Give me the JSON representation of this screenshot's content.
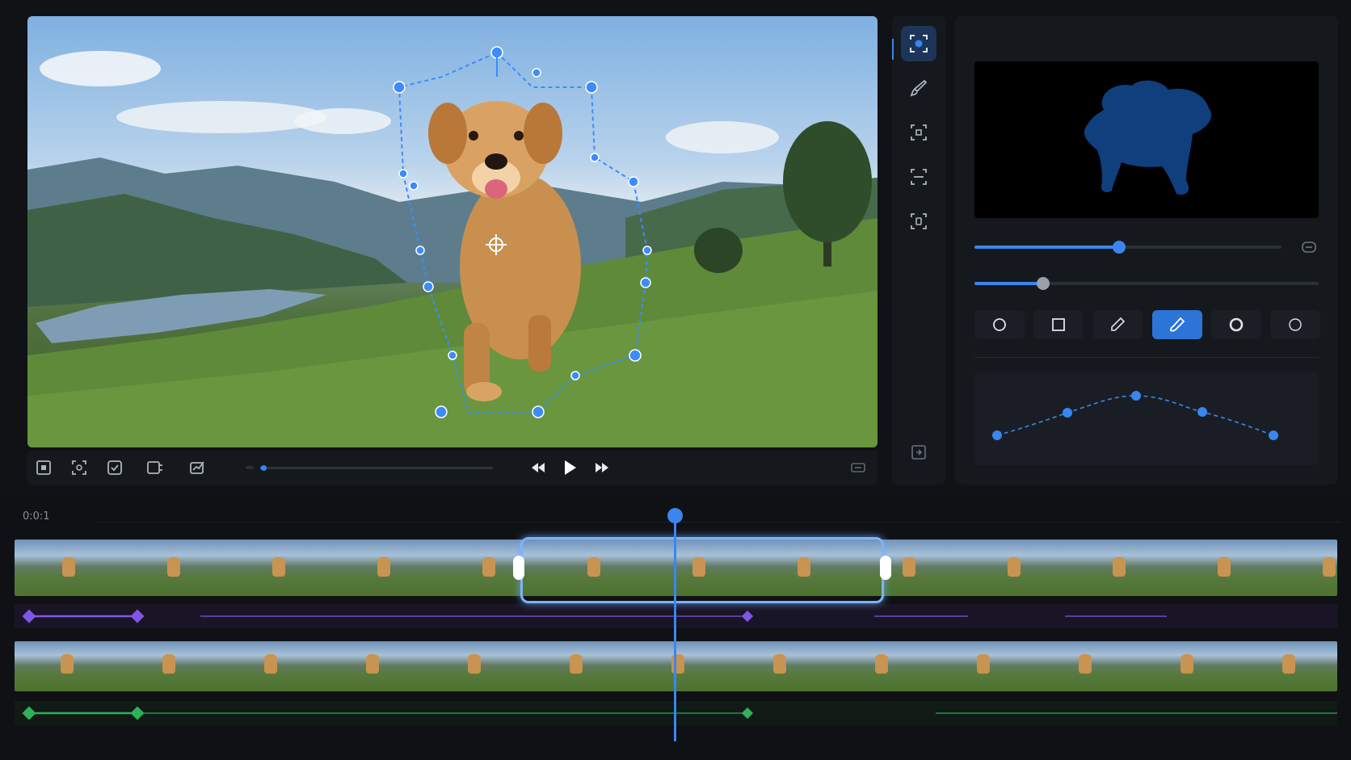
{
  "viewer": {
    "subject_icon": "roto-point-icon",
    "mask_outline_color": "#3d8bfd"
  },
  "transport": {
    "left_tools": [
      "fit-frame-icon",
      "crop-frame-icon",
      "check-frame-icon",
      "split-frame-icon",
      "trend-frame-icon"
    ],
    "progress": 0.01,
    "controls": [
      "skip-back-icon",
      "play-icon",
      "skip-forward-icon"
    ],
    "right_tool": "fullscreen-icon"
  },
  "toolstrip": {
    "tools": [
      "select-subject-icon",
      "brush-icon",
      "focus-frame-icon",
      "track-frame-icon",
      "mask-frame-icon"
    ],
    "active_tool": 0,
    "bottom_tool": "export-frame-icon"
  },
  "panel": {
    "mask_fill_color": "#0f3f7c",
    "slider_1": 0.47,
    "slider_2": 0.2,
    "slider_color": "#3a86f0",
    "reset_icon": "reset-icon",
    "brushes": [
      "circle-brush-icon",
      "square-brush-icon",
      "pen-brush-icon",
      "lasso-brush-icon",
      "ring-brush-icon",
      "soft-brush-icon"
    ],
    "active_brush": 3
  },
  "timeline": {
    "timecode": "0:0:1",
    "playhead_color": "#3a86f0",
    "keyframe_lane_1_color": "#7e57e8",
    "keyframe_lane_2_color": "#2fb05a"
  }
}
